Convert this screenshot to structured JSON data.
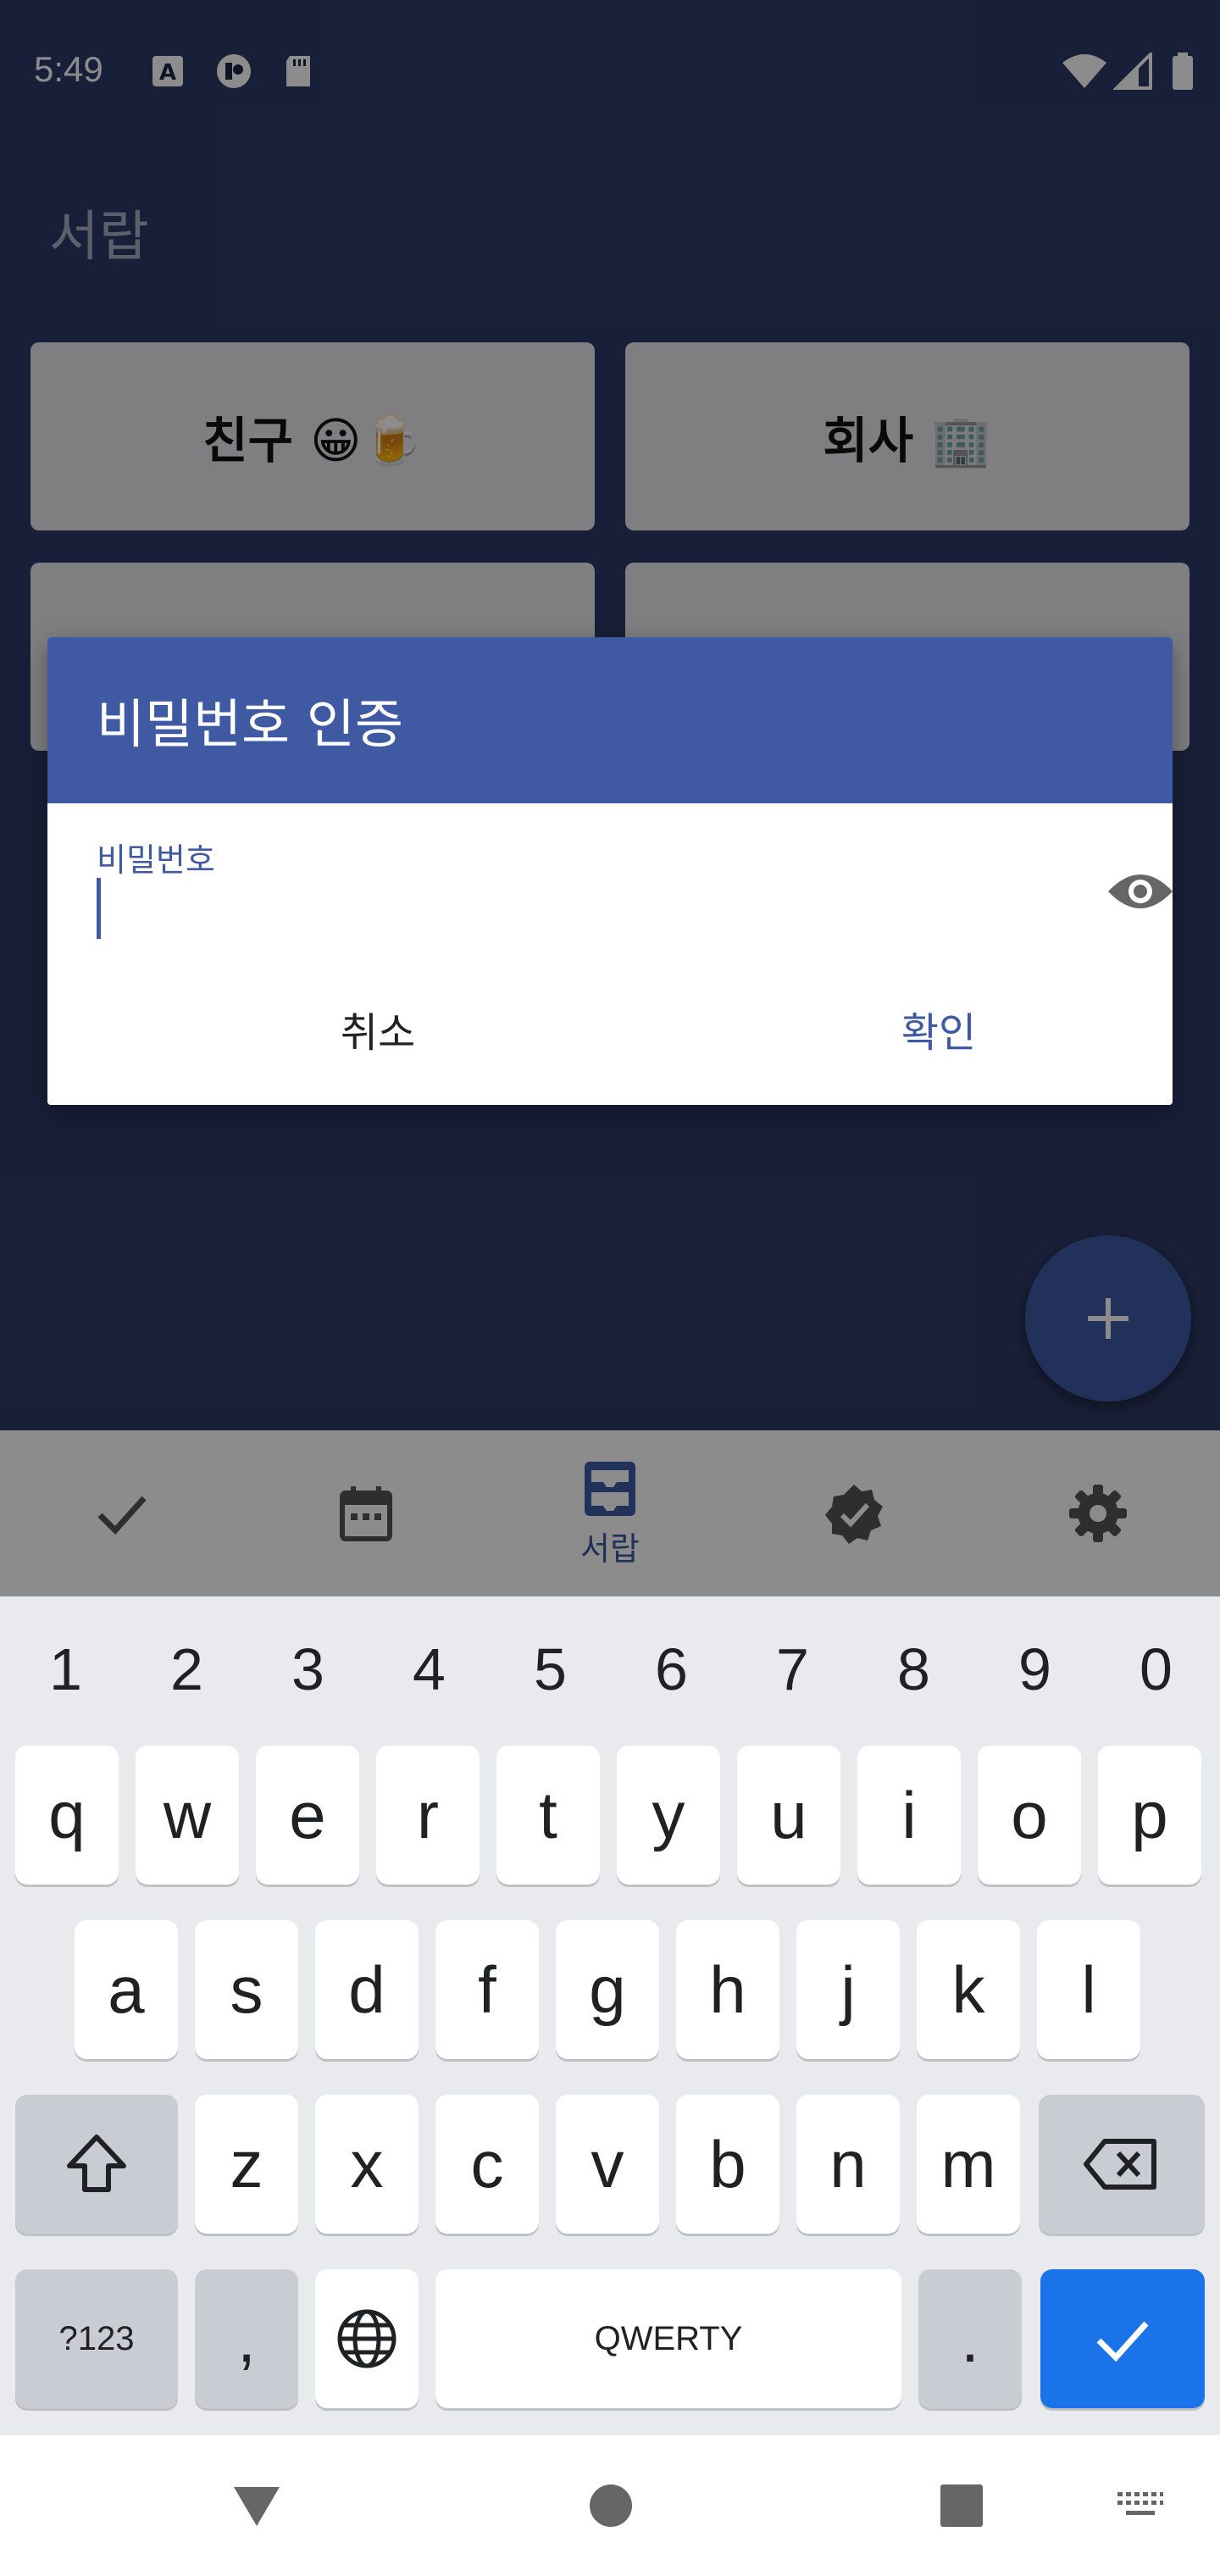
{
  "status_bar": {
    "time": "5:49",
    "left_icons": [
      "keyboard-a-icon",
      "app-badge-icon",
      "sd-card-icon"
    ],
    "right_icons": [
      "wifi-icon",
      "signal-icon",
      "battery-icon"
    ]
  },
  "app": {
    "title": "서랍",
    "drawers": [
      {
        "label": "친구 😀🍺"
      },
      {
        "label": "회사 🏢"
      },
      {
        "label": ""
      },
      {
        "label": ""
      }
    ],
    "fab_icon": "plus-icon",
    "bottom_nav": [
      {
        "icon": "check-icon",
        "label": ""
      },
      {
        "icon": "calendar-icon",
        "label": ""
      },
      {
        "icon": "drawer-icon",
        "label": "서랍"
      },
      {
        "icon": "verified-icon",
        "label": ""
      },
      {
        "icon": "settings-icon",
        "label": ""
      }
    ]
  },
  "dialog": {
    "title": "비밀번호 인증",
    "field_label": "비밀번호",
    "field_value": "",
    "visibility_icon": "eye-icon",
    "cancel_label": "취소",
    "ok_label": "확인"
  },
  "keyboard": {
    "numbers": [
      "1",
      "2",
      "3",
      "4",
      "5",
      "6",
      "7",
      "8",
      "9",
      "0"
    ],
    "row1": [
      "q",
      "w",
      "e",
      "r",
      "t",
      "y",
      "u",
      "i",
      "o",
      "p"
    ],
    "row2": [
      "a",
      "s",
      "d",
      "f",
      "g",
      "h",
      "j",
      "k",
      "l"
    ],
    "row3": [
      "z",
      "x",
      "c",
      "v",
      "b",
      "n",
      "m"
    ],
    "symbols_label": "?123",
    "comma_label": ",",
    "space_label": "QWERTY",
    "period_label": "."
  },
  "colors": {
    "primary": "#3f5aa3",
    "background": "#2d3a66",
    "keyboard_accent": "#1a73e8"
  }
}
